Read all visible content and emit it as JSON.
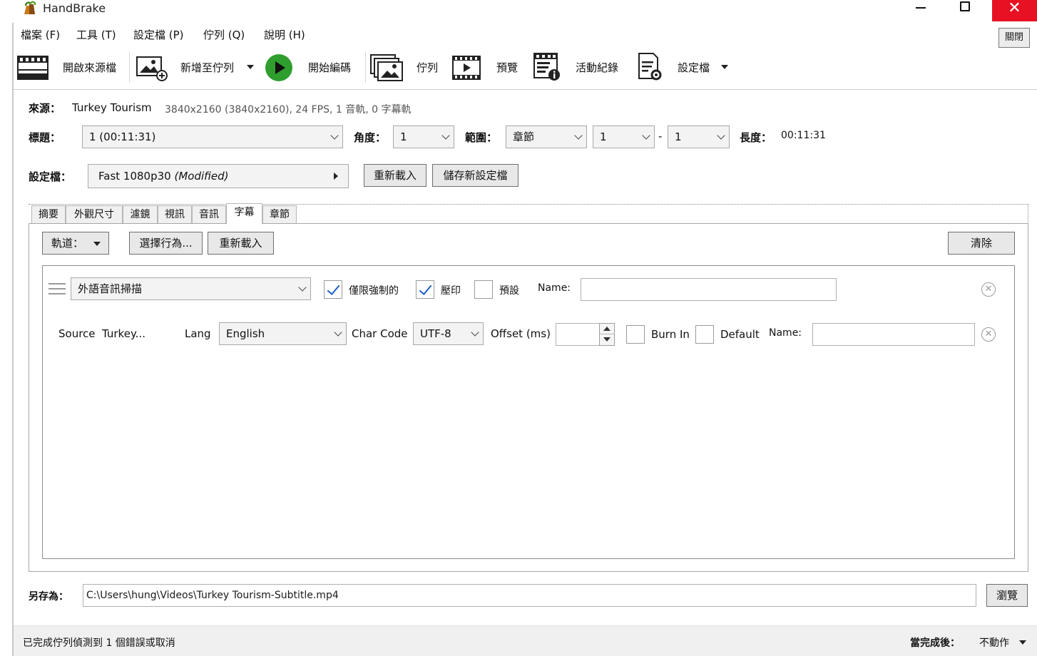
{
  "window": {
    "title": "HandBrake",
    "close_glyph": "✕",
    "accent_close": "#e81123"
  },
  "menu": {
    "items": [
      "檔案 (F)",
      "工具 (T)",
      "設定檔 (P)",
      "佇列 (Q)",
      "說明 (H)"
    ],
    "close_button": "關閉"
  },
  "toolbar": {
    "open_source": "開啟來源檔",
    "add_to_queue": "新增至佇列",
    "start_encode": "開始編碼",
    "queue": "佇列",
    "preview": "預覽",
    "activity_log": "活動紀錄",
    "presets": "設定檔",
    "play_color": "#2f9e2f"
  },
  "source": {
    "label": "來源：",
    "name": "Turkey Tourism",
    "info": "3840x2160 (3840x2160), 24 FPS, 1 音軌, 0 字幕軌"
  },
  "title_row": {
    "title_label": "標題：",
    "title_value": "1  (00:11:31)",
    "angle_label": "角度：",
    "angle_value": "1",
    "range_label": "範圍：",
    "range_type": "章節",
    "range_start": "1",
    "range_dash": "-",
    "range_end": "1",
    "duration_label": "長度：",
    "duration_value": "00:11:31"
  },
  "preset_row": {
    "label": "設定檔：",
    "preset_name": "Fast 1080p30",
    "preset_modified": "(Modified)",
    "reload_button": "重新載入",
    "save_new_button": "儲存新設定檔"
  },
  "tabs": [
    "摘要",
    "外觀尺寸",
    "濾鏡",
    "視訊",
    "音訊",
    "字幕",
    "章節"
  ],
  "active_tab": "字幕",
  "subtitles": {
    "tracks_button": "軌道：",
    "selection_behavior_button": "選擇行為...",
    "reload_button": "重新載入",
    "clear_button": "清除",
    "row1": {
      "track_value": "外語音訊掃描",
      "forced_only_label": "僅限強制的",
      "forced_only_checked": true,
      "burn_in_label": "壓印",
      "burn_in_checked": true,
      "default_label": "預設",
      "default_checked": false,
      "name_label": "Name:",
      "name_value": ""
    },
    "row2": {
      "source_label": "Source",
      "source_value": "Turkey...",
      "lang_label": "Lang",
      "lang_value": "English",
      "charcode_label": "Char Code",
      "charcode_value": "UTF-8",
      "offset_label": "Offset (ms)",
      "offset_value": "",
      "burn_in_label": "Burn In",
      "burn_in_checked": false,
      "default_label": "Default",
      "default_checked": false,
      "name_label": "Name:",
      "name_value": ""
    }
  },
  "save_as": {
    "label": "另存為：",
    "path": "C:\\Users\\hung\\Videos\\Turkey Tourism-Subtitle.mp4",
    "browse_button": "瀏覽"
  },
  "status": {
    "message": "已完成佇列偵測到 1 個錯誤或取消",
    "when_done_label": "當完成後：",
    "when_done_value": "不動作"
  }
}
